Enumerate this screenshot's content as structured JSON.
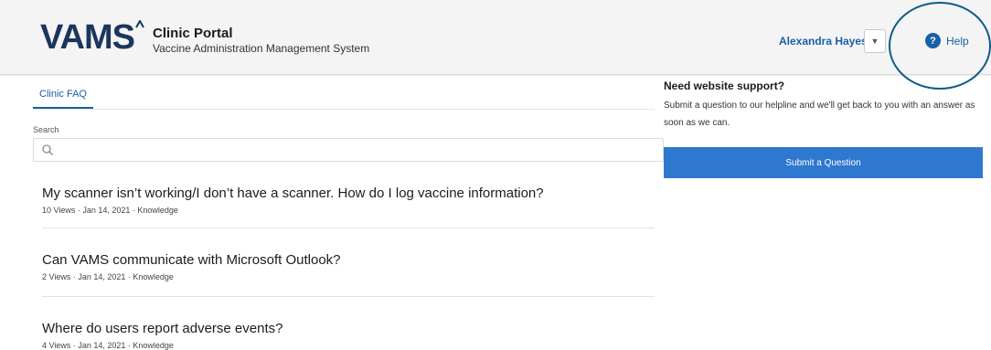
{
  "header": {
    "logo_text": "VAMS",
    "portal_title": "Clinic Portal",
    "portal_subtitle": "Vaccine Administration Management System",
    "user_name": "Alexandra Hayes",
    "help_label": "Help"
  },
  "tabs": [
    {
      "label": "Clinic FAQ",
      "active": true
    }
  ],
  "search": {
    "label": "Search",
    "value": "",
    "placeholder": ""
  },
  "articles": [
    {
      "title": "My scanner isn’t working/I don’t have a scanner. How do I log vaccine information?",
      "meta": "10 Views  ·  Jan 14, 2021  ·  Knowledge"
    },
    {
      "title": "Can VAMS communicate with Microsoft Outlook?",
      "meta": "2 Views  ·  Jan 14, 2021  ·  Knowledge"
    },
    {
      "title": "Where do users report adverse events?",
      "meta": "4 Views  ·  Jan 14, 2021  ·  Knowledge"
    }
  ],
  "support": {
    "heading": "Need website support?",
    "text": "Submit a question to our helpline and we'll get back to you with an answer as soon as we can.",
    "button_label": "Submit a Question"
  },
  "colors": {
    "brand_navy": "#1b365d",
    "link_blue": "#1b5fa8",
    "button_blue": "#2f78cf",
    "annotation_circle": "#0e5c8a"
  },
  "icons": [
    "chevron-down-icon",
    "help-icon",
    "search-icon",
    "logo-mark-icon"
  ]
}
